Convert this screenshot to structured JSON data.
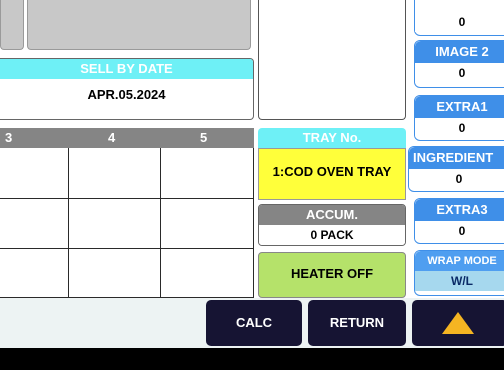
{
  "sell_by": {
    "label": "SELL BY DATE",
    "value": "APR.05.2024"
  },
  "grid": {
    "columns": [
      "3",
      "4",
      "5"
    ]
  },
  "tray": {
    "label": "TRAY No.",
    "value": "1:COD OVEN TRAY"
  },
  "accum": {
    "label": "ACCUM.",
    "value": "0 PACK"
  },
  "heater": {
    "label": "HEATER OFF"
  },
  "right_column": {
    "top_value": "0",
    "image2": {
      "label": "IMAGE 2",
      "value": "0"
    },
    "extra1": {
      "label": "EXTRA1",
      "value": "0"
    },
    "ingredient": {
      "label": "INGREDIENT",
      "value": "0"
    },
    "extra3": {
      "label": "EXTRA3",
      "value": "0"
    },
    "wrap_mode": {
      "label": "WRAP MODE",
      "value": "W/L"
    }
  },
  "bottom_bar": {
    "calc_label": "CALC",
    "return_label": "RETURN",
    "up_icon": "up-arrow-icon"
  },
  "colors": {
    "cyan": "#6ef0f6",
    "yellow": "#ffff3a",
    "green": "#b5e26a",
    "blue": "#3f8fe8",
    "dark": "#161433"
  }
}
